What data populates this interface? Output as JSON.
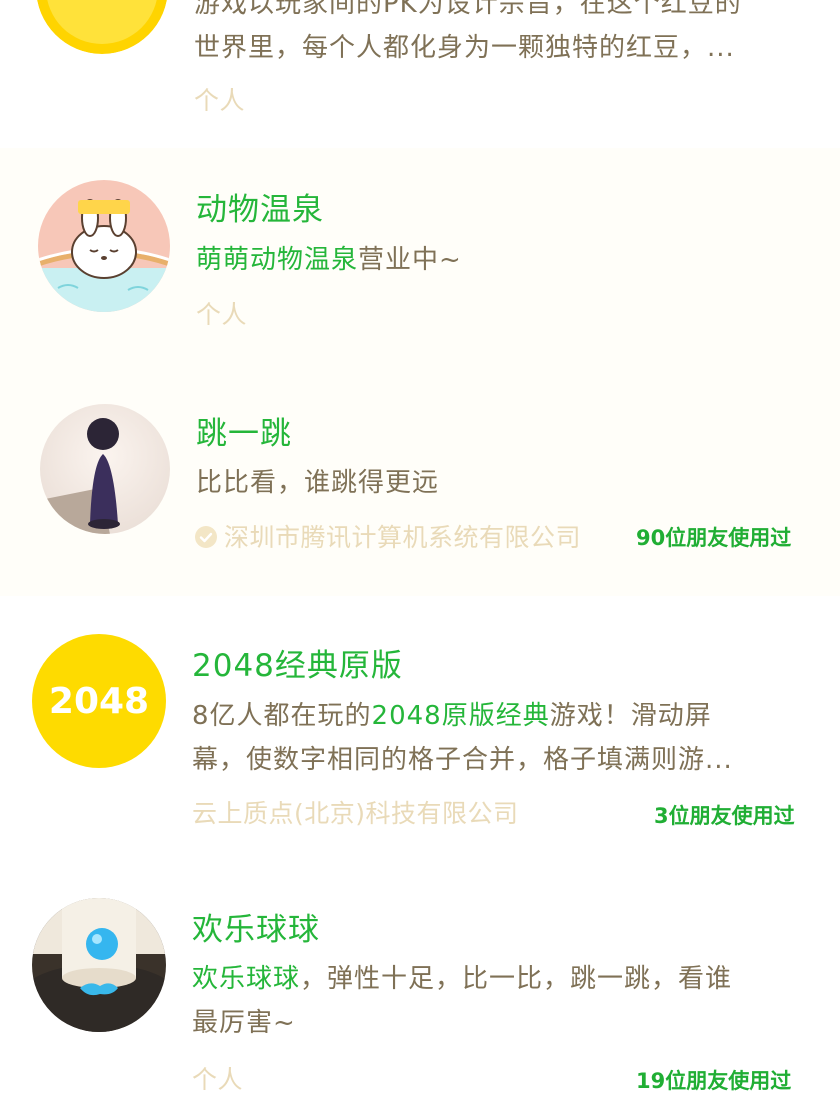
{
  "items": [
    {
      "title": "",
      "desc_line1": "游戏以玩家间的PK为设计宗旨，在这个红豆的",
      "desc_line2": "世界里，每个人都化身为一颗独特的红豆，...",
      "sub": "个人",
      "friends": ""
    },
    {
      "title": "动物温泉",
      "desc_hl": "萌萌动物温泉",
      "desc_rest": "营业中~",
      "sub": "个人",
      "friends": ""
    },
    {
      "title": "跳一跳",
      "desc": "比比看，谁跳得更远",
      "sub": "深圳市腾讯计算机系统有限公司",
      "verified": true,
      "friends": "90位朋友使用过"
    },
    {
      "title": "2048经典原版",
      "desc_pre": "8亿人都在玩的",
      "desc_hl": "2048原版经典",
      "desc_post": "游戏！滑动屏",
      "desc_line2": "幕，使数字相同的格子合并，格子填满则游...",
      "sub": "云上质点(北京)科技有限公司",
      "friends": "3位朋友使用过",
      "avatar_text": "2048"
    },
    {
      "title": "欢乐球球",
      "desc_hl": "欢乐球球",
      "desc_post": "，弹性十足，比一比，跳一跳，看谁",
      "desc_line2": "最厉害~",
      "sub": "个人",
      "friends": "19位朋友使用过"
    }
  ],
  "colors": {
    "title_green": "#25b63a",
    "desc_brown": "#7f7156",
    "sub_beige": "#e9dab8"
  }
}
